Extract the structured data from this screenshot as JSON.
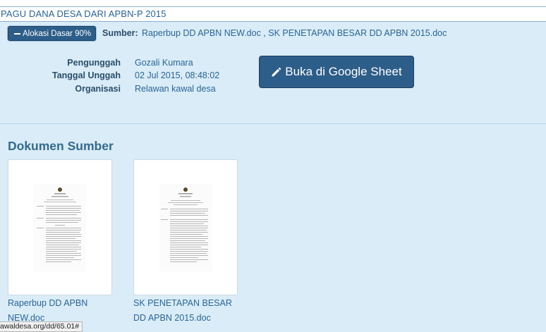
{
  "header": {
    "title": "PAGU DANA DESA DARI APBN-P 2015"
  },
  "alokasi": {
    "label": "Alokasi Dasar 90%"
  },
  "sumber": {
    "label": "Sumber:",
    "links": "Raperbup DD APBN NEW.doc , SK PENETAPAN BESAR DD APBN 2015.doc"
  },
  "meta": {
    "uploader_label": "Pengunggah",
    "uploader_value": "Gozali Kumara",
    "date_label": "Tanggal Unggah",
    "date_value": "02 Jul 2015, 08:48:02",
    "org_label": "Organisasi",
    "org_value": "Relawan kawal desa"
  },
  "sheet_button": {
    "label": "Buka di Google Sheet",
    "icon": "pencil-icon"
  },
  "documents": {
    "title": "Dokumen Sumber",
    "items": [
      {
        "line1": "Raperbup DD APBN",
        "line2": "NEW.doc"
      },
      {
        "line1": "SK PENETAPAN BESAR",
        "line2": "DD APBN 2015.doc"
      }
    ]
  },
  "status_bar": {
    "url": "awaldesa.org/dd/65.01#"
  },
  "colors": {
    "button": "#2d5d89",
    "background": "#d9ecf7",
    "link": "#2a6496"
  }
}
